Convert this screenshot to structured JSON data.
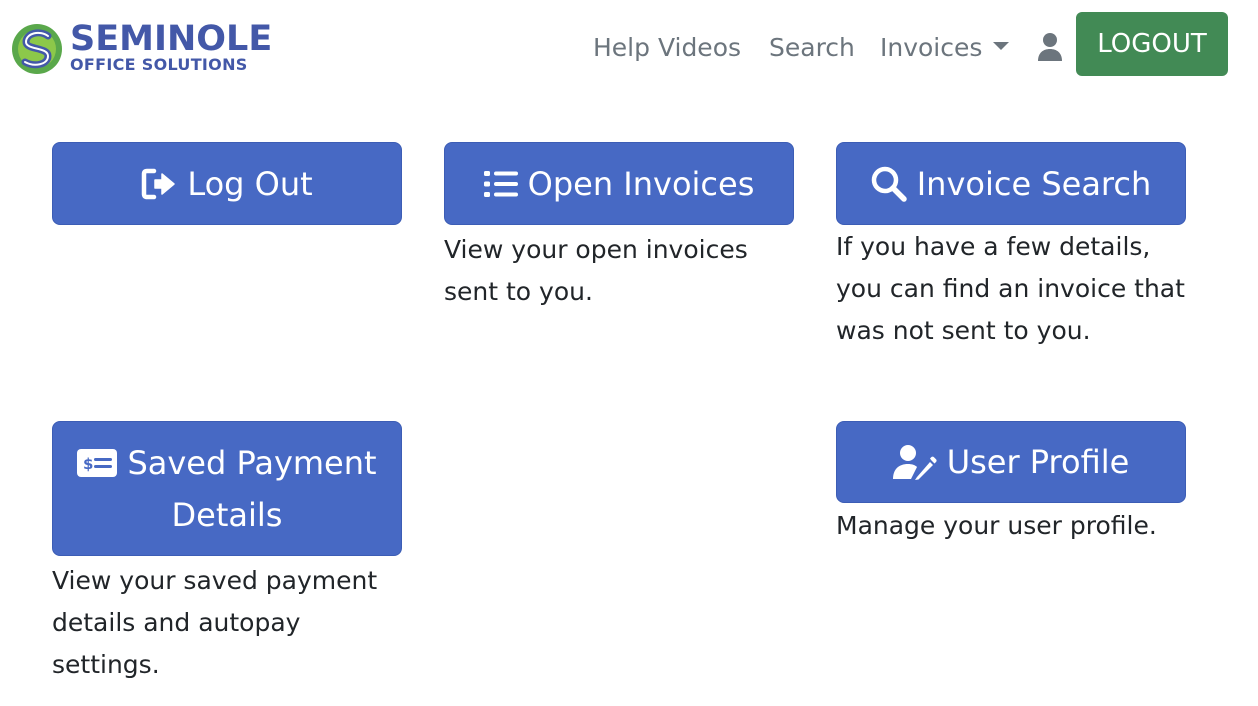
{
  "brand": {
    "name_line1": "SEMINOLE",
    "name_line2": "OFFICE SOLUTIONS",
    "colors": {
      "blue": "#4358a8",
      "green": "#5aa84b"
    }
  },
  "nav": {
    "help_videos": "Help Videos",
    "search": "Search",
    "invoices": "Invoices",
    "user_icon": "user-icon",
    "logout": "LOGOUT"
  },
  "tiles": {
    "log_out": {
      "label": "Log Out",
      "icon": "sign-out-icon"
    },
    "open_invoices": {
      "label": "Open Invoices",
      "icon": "list-icon",
      "description": "View your open invoices sent to you."
    },
    "invoice_search": {
      "label": "Invoice Search",
      "icon": "search-icon",
      "description": "If you have a few details, you can find an invoice that was not sent to you."
    },
    "saved_payment": {
      "label_line1": "Saved Payment",
      "label_line2": "Details",
      "icon": "money-check-icon",
      "description": "View your saved payment details and autopay settings."
    },
    "user_profile": {
      "label": "User Profile",
      "icon": "user-edit-icon",
      "description": "Manage your user profile."
    }
  },
  "colors": {
    "tile_button": "#4769c4",
    "logout_button": "#428a55",
    "nav_text": "#6c757d"
  }
}
